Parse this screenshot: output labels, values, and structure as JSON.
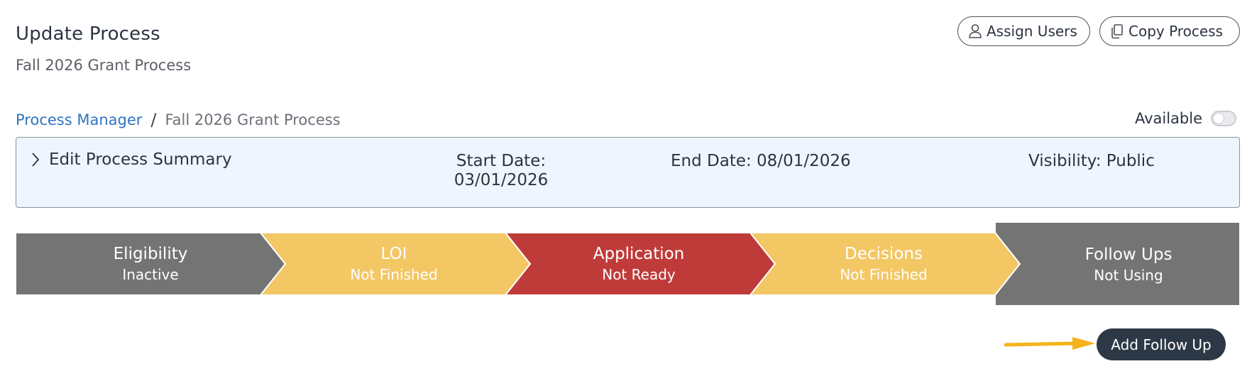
{
  "header": {
    "title": "Update Process",
    "subtitle": "Fall 2026 Grant Process",
    "assign_users_label": "Assign Users",
    "copy_process_label": "Copy Process"
  },
  "breadcrumb": {
    "link": "Process Manager",
    "separator": "/",
    "current": "Fall 2026 Grant Process"
  },
  "availability": {
    "label": "Available",
    "enabled": false
  },
  "summary": {
    "toggle_label": "Edit Process Summary",
    "start_label": "Start Date:",
    "start_value": "03/01/2026",
    "end": "End Date: 08/01/2026",
    "visibility": "Visibility: Public"
  },
  "stages": [
    {
      "name": "Eligibility",
      "status": "Inactive",
      "color": "#747474"
    },
    {
      "name": "LOI",
      "status": "Not Finished",
      "color": "#f3c764"
    },
    {
      "name": "Application",
      "status": "Not Ready",
      "color": "#bf3b3a"
    },
    {
      "name": "Decisions",
      "status": "Not Finished",
      "color": "#f3c764"
    },
    {
      "name": "Follow Ups",
      "status": "Not Using",
      "color": "#747474",
      "active": true
    }
  ],
  "actions": {
    "add_follow_up_label": "Add Follow Up"
  },
  "colors": {
    "arrow": "#f5b21c",
    "link": "#2f74c0",
    "dark_button": "#2d3846",
    "summary_bg": "#eef5fe"
  }
}
